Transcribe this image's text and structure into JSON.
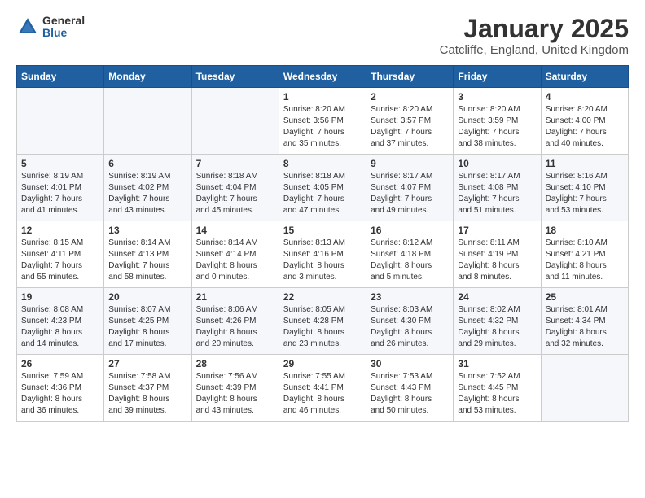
{
  "header": {
    "logo_general": "General",
    "logo_blue": "Blue",
    "month_title": "January 2025",
    "location": "Catcliffe, England, United Kingdom"
  },
  "weekdays": [
    "Sunday",
    "Monday",
    "Tuesday",
    "Wednesday",
    "Thursday",
    "Friday",
    "Saturday"
  ],
  "weeks": [
    [
      {
        "day": "",
        "info": ""
      },
      {
        "day": "",
        "info": ""
      },
      {
        "day": "",
        "info": ""
      },
      {
        "day": "1",
        "info": "Sunrise: 8:20 AM\nSunset: 3:56 PM\nDaylight: 7 hours\nand 35 minutes."
      },
      {
        "day": "2",
        "info": "Sunrise: 8:20 AM\nSunset: 3:57 PM\nDaylight: 7 hours\nand 37 minutes."
      },
      {
        "day": "3",
        "info": "Sunrise: 8:20 AM\nSunset: 3:59 PM\nDaylight: 7 hours\nand 38 minutes."
      },
      {
        "day": "4",
        "info": "Sunrise: 8:20 AM\nSunset: 4:00 PM\nDaylight: 7 hours\nand 40 minutes."
      }
    ],
    [
      {
        "day": "5",
        "info": "Sunrise: 8:19 AM\nSunset: 4:01 PM\nDaylight: 7 hours\nand 41 minutes."
      },
      {
        "day": "6",
        "info": "Sunrise: 8:19 AM\nSunset: 4:02 PM\nDaylight: 7 hours\nand 43 minutes."
      },
      {
        "day": "7",
        "info": "Sunrise: 8:18 AM\nSunset: 4:04 PM\nDaylight: 7 hours\nand 45 minutes."
      },
      {
        "day": "8",
        "info": "Sunrise: 8:18 AM\nSunset: 4:05 PM\nDaylight: 7 hours\nand 47 minutes."
      },
      {
        "day": "9",
        "info": "Sunrise: 8:17 AM\nSunset: 4:07 PM\nDaylight: 7 hours\nand 49 minutes."
      },
      {
        "day": "10",
        "info": "Sunrise: 8:17 AM\nSunset: 4:08 PM\nDaylight: 7 hours\nand 51 minutes."
      },
      {
        "day": "11",
        "info": "Sunrise: 8:16 AM\nSunset: 4:10 PM\nDaylight: 7 hours\nand 53 minutes."
      }
    ],
    [
      {
        "day": "12",
        "info": "Sunrise: 8:15 AM\nSunset: 4:11 PM\nDaylight: 7 hours\nand 55 minutes."
      },
      {
        "day": "13",
        "info": "Sunrise: 8:14 AM\nSunset: 4:13 PM\nDaylight: 7 hours\nand 58 minutes."
      },
      {
        "day": "14",
        "info": "Sunrise: 8:14 AM\nSunset: 4:14 PM\nDaylight: 8 hours\nand 0 minutes."
      },
      {
        "day": "15",
        "info": "Sunrise: 8:13 AM\nSunset: 4:16 PM\nDaylight: 8 hours\nand 3 minutes."
      },
      {
        "day": "16",
        "info": "Sunrise: 8:12 AM\nSunset: 4:18 PM\nDaylight: 8 hours\nand 5 minutes."
      },
      {
        "day": "17",
        "info": "Sunrise: 8:11 AM\nSunset: 4:19 PM\nDaylight: 8 hours\nand 8 minutes."
      },
      {
        "day": "18",
        "info": "Sunrise: 8:10 AM\nSunset: 4:21 PM\nDaylight: 8 hours\nand 11 minutes."
      }
    ],
    [
      {
        "day": "19",
        "info": "Sunrise: 8:08 AM\nSunset: 4:23 PM\nDaylight: 8 hours\nand 14 minutes."
      },
      {
        "day": "20",
        "info": "Sunrise: 8:07 AM\nSunset: 4:25 PM\nDaylight: 8 hours\nand 17 minutes."
      },
      {
        "day": "21",
        "info": "Sunrise: 8:06 AM\nSunset: 4:26 PM\nDaylight: 8 hours\nand 20 minutes."
      },
      {
        "day": "22",
        "info": "Sunrise: 8:05 AM\nSunset: 4:28 PM\nDaylight: 8 hours\nand 23 minutes."
      },
      {
        "day": "23",
        "info": "Sunrise: 8:03 AM\nSunset: 4:30 PM\nDaylight: 8 hours\nand 26 minutes."
      },
      {
        "day": "24",
        "info": "Sunrise: 8:02 AM\nSunset: 4:32 PM\nDaylight: 8 hours\nand 29 minutes."
      },
      {
        "day": "25",
        "info": "Sunrise: 8:01 AM\nSunset: 4:34 PM\nDaylight: 8 hours\nand 32 minutes."
      }
    ],
    [
      {
        "day": "26",
        "info": "Sunrise: 7:59 AM\nSunset: 4:36 PM\nDaylight: 8 hours\nand 36 minutes."
      },
      {
        "day": "27",
        "info": "Sunrise: 7:58 AM\nSunset: 4:37 PM\nDaylight: 8 hours\nand 39 minutes."
      },
      {
        "day": "28",
        "info": "Sunrise: 7:56 AM\nSunset: 4:39 PM\nDaylight: 8 hours\nand 43 minutes."
      },
      {
        "day": "29",
        "info": "Sunrise: 7:55 AM\nSunset: 4:41 PM\nDaylight: 8 hours\nand 46 minutes."
      },
      {
        "day": "30",
        "info": "Sunrise: 7:53 AM\nSunset: 4:43 PM\nDaylight: 8 hours\nand 50 minutes."
      },
      {
        "day": "31",
        "info": "Sunrise: 7:52 AM\nSunset: 4:45 PM\nDaylight: 8 hours\nand 53 minutes."
      },
      {
        "day": "",
        "info": ""
      }
    ]
  ]
}
